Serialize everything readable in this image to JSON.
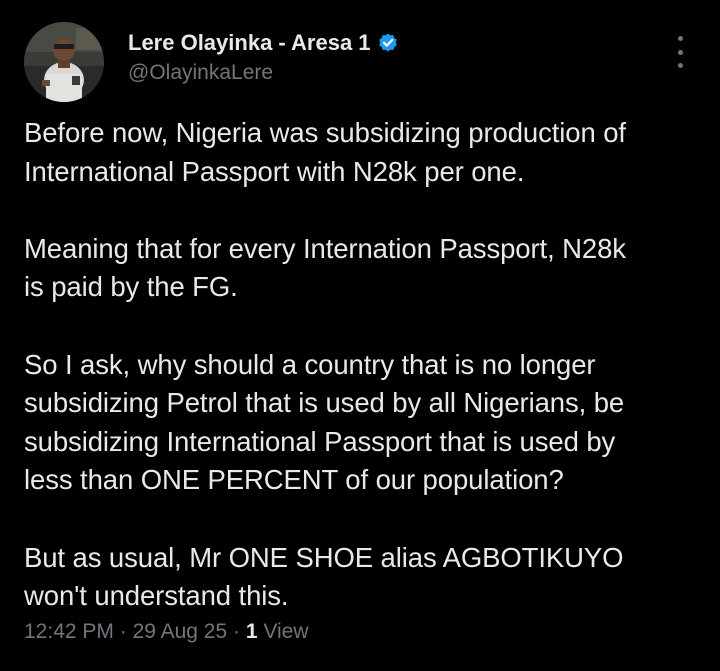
{
  "colors": {
    "background": "#000000",
    "text_primary": "#e7e9ea",
    "text_secondary": "#71767b",
    "verified_badge": "#1d9bf0"
  },
  "author": {
    "display_name": "Lere Olayinka - Aresa 1",
    "handle": "@OlayinkaLere",
    "verified": true,
    "avatar_icon": "profile-photo"
  },
  "more_icon": "more-vertical-icon",
  "tweet": {
    "paragraphs": [
      "Before now, Nigeria was subsidizing production of\nInternational Passport with N28k per one.",
      "Meaning that for every Internation Passport,  N28k\nis paid by the FG.",
      "So I ask, why should a country that is no longer\nsubsidizing Petrol that is used by all Nigerians, be\nsubsidizing International Passport that is used by\nless than ONE PERCENT of our population?",
      "But as usual,  Mr ONE SHOE alias AGBOTIKUYO\nwon't understand this."
    ]
  },
  "meta": {
    "time": "12:42 PM",
    "separator": " · ",
    "date": "29 Aug 25",
    "views_count": "1",
    "views_label": "View"
  }
}
